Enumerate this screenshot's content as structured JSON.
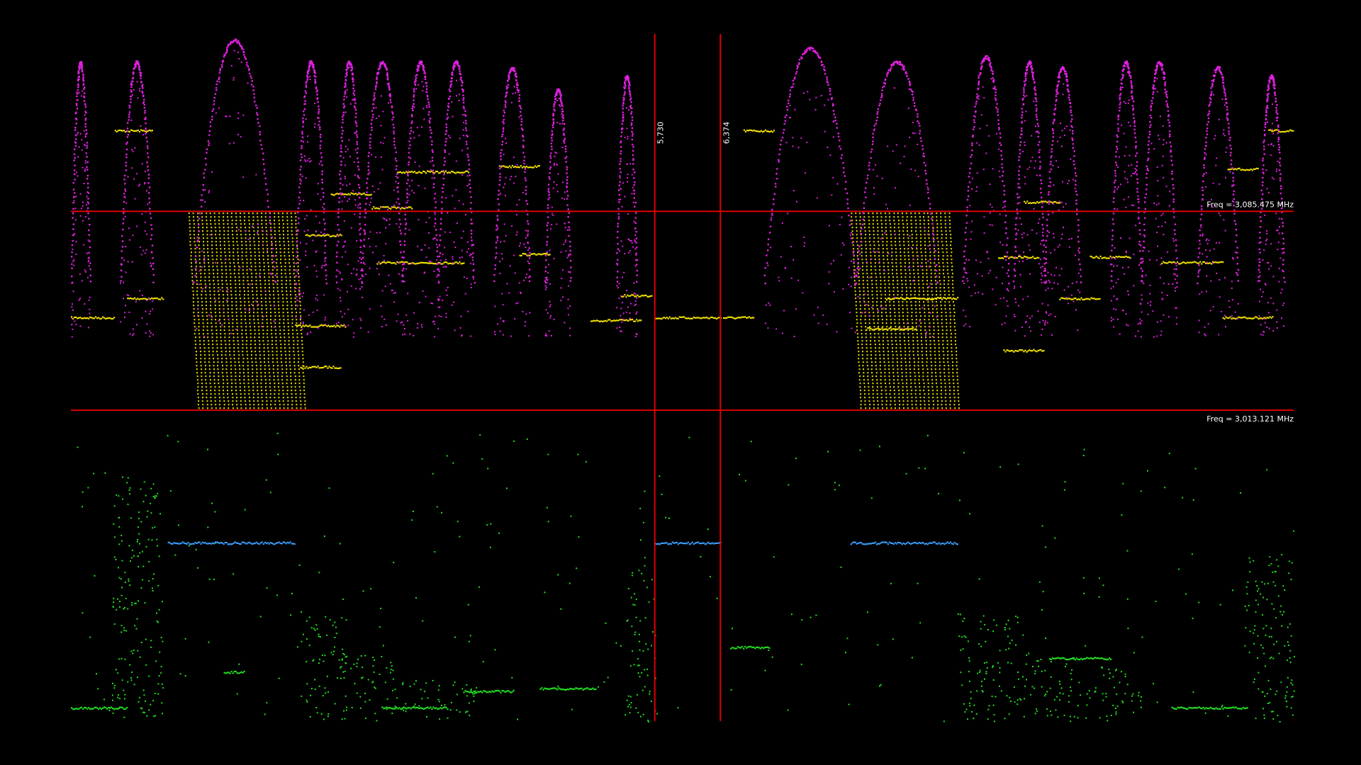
{
  "chart_data": {
    "type": "scatter",
    "background": "#000000",
    "x_range": [
      0,
      12000
    ],
    "y_range": [
      2900,
      3150
    ],
    "colors": {
      "marker": "#e00000",
      "magenta": "#e020e0",
      "yellow": "#f0e000",
      "green": "#22e022",
      "blue": "#3aa0ff"
    },
    "markers": {
      "vertical": [
        {
          "value": 5730,
          "label": "5,730"
        },
        {
          "value": 6374,
          "label": "6,374"
        }
      ],
      "horizontal": [
        {
          "value": 3085.475,
          "label": "Freq = 3,085.475 MHz"
        },
        {
          "value": 3013.121,
          "label": "Freq = 3,013.121 MHz"
        }
      ]
    },
    "series": [
      {
        "color_key": "yellow",
        "style": "steps",
        "segments": [
          {
            "x0": 0,
            "x1": 420,
            "y": 3047
          },
          {
            "x0": 430,
            "x1": 800,
            "y": 3115
          },
          {
            "x0": 550,
            "x1": 900,
            "y": 3054
          },
          {
            "x0": 2200,
            "x1": 2700,
            "y": 3044
          },
          {
            "x0": 2250,
            "x1": 2650,
            "y": 3029
          },
          {
            "x0": 2300,
            "x1": 2650,
            "y": 3077
          },
          {
            "x0": 2550,
            "x1": 2950,
            "y": 3092
          },
          {
            "x0": 2950,
            "x1": 3350,
            "y": 3087
          },
          {
            "x0": 3000,
            "x1": 3850,
            "y": 3067
          },
          {
            "x0": 3200,
            "x1": 3900,
            "y": 3100
          },
          {
            "x0": 4200,
            "x1": 4600,
            "y": 3102
          },
          {
            "x0": 4400,
            "x1": 4700,
            "y": 3070
          },
          {
            "x0": 5100,
            "x1": 5600,
            "y": 3046
          },
          {
            "x0": 5400,
            "x1": 5700,
            "y": 3055
          },
          {
            "x0": 5730,
            "x1": 6374,
            "y": 3047
          },
          {
            "x0": 6400,
            "x1": 6700,
            "y": 3047
          },
          {
            "x0": 6600,
            "x1": 6900,
            "y": 3115
          },
          {
            "x0": 7800,
            "x1": 8300,
            "y": 3043
          },
          {
            "x0": 8000,
            "x1": 8700,
            "y": 3054
          },
          {
            "x0": 9100,
            "x1": 9500,
            "y": 3069
          },
          {
            "x0": 9150,
            "x1": 9550,
            "y": 3035
          },
          {
            "x0": 9350,
            "x1": 9700,
            "y": 3089
          },
          {
            "x0": 9700,
            "x1": 10100,
            "y": 3054
          },
          {
            "x0": 10000,
            "x1": 10400,
            "y": 3069
          },
          {
            "x0": 10700,
            "x1": 11300,
            "y": 3067
          },
          {
            "x0": 11300,
            "x1": 11800,
            "y": 3047
          },
          {
            "x0": 11350,
            "x1": 11650,
            "y": 3101
          },
          {
            "x0": 11750,
            "x1": 12000,
            "y": 3115
          }
        ],
        "dense_blocks": [
          {
            "x0": 1150,
            "x1": 2200,
            "y0": 3013,
            "y1": 3085
          },
          {
            "x0": 7650,
            "x1": 8650,
            "y0": 3013,
            "y1": 3085
          }
        ]
      },
      {
        "color_key": "magenta",
        "style": "arcs",
        "arcs": [
          {
            "x0": 0,
            "x1": 180,
            "peak": 3140
          },
          {
            "x0": 480,
            "x1": 800,
            "peak": 3140
          },
          {
            "x0": 1200,
            "x1": 2000,
            "peak": 3148
          },
          {
            "x0": 2200,
            "x1": 2500,
            "peak": 3140
          },
          {
            "x0": 2600,
            "x1": 2850,
            "peak": 3140
          },
          {
            "x0": 2850,
            "x1": 3250,
            "peak": 3140
          },
          {
            "x0": 3250,
            "x1": 3600,
            "peak": 3140
          },
          {
            "x0": 3600,
            "x1": 3950,
            "peak": 3140
          },
          {
            "x0": 4150,
            "x1": 4500,
            "peak": 3138
          },
          {
            "x0": 4650,
            "x1": 4900,
            "peak": 3130
          },
          {
            "x0": 5350,
            "x1": 5550,
            "peak": 3135
          },
          {
            "x0": 6800,
            "x1": 7700,
            "peak": 3145
          },
          {
            "x0": 7700,
            "x1": 8500,
            "peak": 3140
          },
          {
            "x0": 8750,
            "x1": 9200,
            "peak": 3142
          },
          {
            "x0": 9250,
            "x1": 9550,
            "peak": 3140
          },
          {
            "x0": 9550,
            "x1": 9900,
            "peak": 3138
          },
          {
            "x0": 10200,
            "x1": 10500,
            "peak": 3140
          },
          {
            "x0": 10500,
            "x1": 10850,
            "peak": 3140
          },
          {
            "x0": 11050,
            "x1": 11450,
            "peak": 3138
          },
          {
            "x0": 11650,
            "x1": 11900,
            "peak": 3135
          }
        ]
      },
      {
        "color_key": "green",
        "style": "scatter-steps",
        "segments": [
          {
            "x0": 0,
            "x1": 550,
            "y": 2905
          },
          {
            "x0": 3050,
            "x1": 3700,
            "y": 2905
          },
          {
            "x0": 3850,
            "x1": 4350,
            "y": 2911
          },
          {
            "x0": 4600,
            "x1": 5150,
            "y": 2912
          },
          {
            "x0": 6470,
            "x1": 6850,
            "y": 2927
          },
          {
            "x0": 9600,
            "x1": 10200,
            "y": 2923
          },
          {
            "x0": 10800,
            "x1": 11550,
            "y": 2905
          },
          {
            "x0": 1500,
            "x1": 1700,
            "y": 2918
          }
        ],
        "clusters": [
          {
            "x0": 400,
            "x1": 900,
            "y0": 2900,
            "y1": 2990
          },
          {
            "x0": 2250,
            "x1": 2700,
            "y0": 2900,
            "y1": 2940
          },
          {
            "x0": 2650,
            "x1": 3200,
            "y0": 2900,
            "y1": 2925
          },
          {
            "x0": 3200,
            "x1": 4000,
            "y0": 2900,
            "y1": 2915
          },
          {
            "x0": 5450,
            "x1": 5730,
            "y0": 2900,
            "y1": 2960
          },
          {
            "x0": 8700,
            "x1": 9300,
            "y0": 2900,
            "y1": 2940
          },
          {
            "x0": 9300,
            "x1": 9900,
            "y0": 2900,
            "y1": 2925
          },
          {
            "x0": 9950,
            "x1": 10500,
            "y0": 2900,
            "y1": 2920
          },
          {
            "x0": 11500,
            "x1": 12000,
            "y0": 2900,
            "y1": 2960
          }
        ]
      },
      {
        "color_key": "blue",
        "style": "steps",
        "segments": [
          {
            "x0": 950,
            "x1": 2200,
            "y": 2965
          },
          {
            "x0": 5730,
            "x1": 6374,
            "y": 2965
          },
          {
            "x0": 7650,
            "x1": 8700,
            "y": 2965
          }
        ]
      }
    ]
  }
}
